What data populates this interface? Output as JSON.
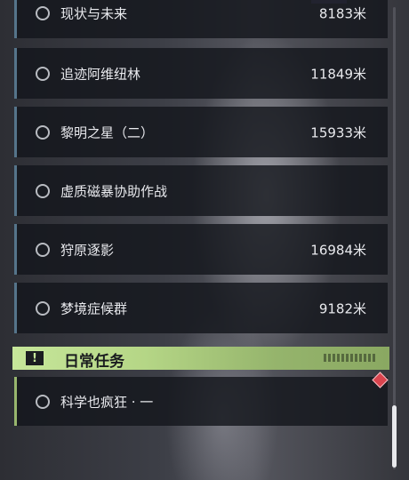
{
  "quests": [
    {
      "name": "现状与未来",
      "distance": "8183米"
    },
    {
      "name": "追迹阿维纽林",
      "distance": "11849米"
    },
    {
      "name": "黎明之星（二）",
      "distance": "15933米"
    },
    {
      "name": "虚质磁暴协助作战",
      "distance": ""
    },
    {
      "name": "狩原逐影",
      "distance": "16984米"
    },
    {
      "name": "梦境症候群",
      "distance": "9182米"
    }
  ],
  "daily_section": {
    "badge": "!",
    "title": "日常任务",
    "quests": [
      {
        "name": "科学也疯狂 · 一",
        "distance": ""
      }
    ]
  },
  "colors": {
    "quest_bar": "#55748a",
    "daily_accent": "#c6e69a",
    "marker": "#d9444e"
  },
  "icons": {
    "status": "circle-icon",
    "section": "exclamation-icon",
    "marker": "diamond-marker-icon"
  }
}
